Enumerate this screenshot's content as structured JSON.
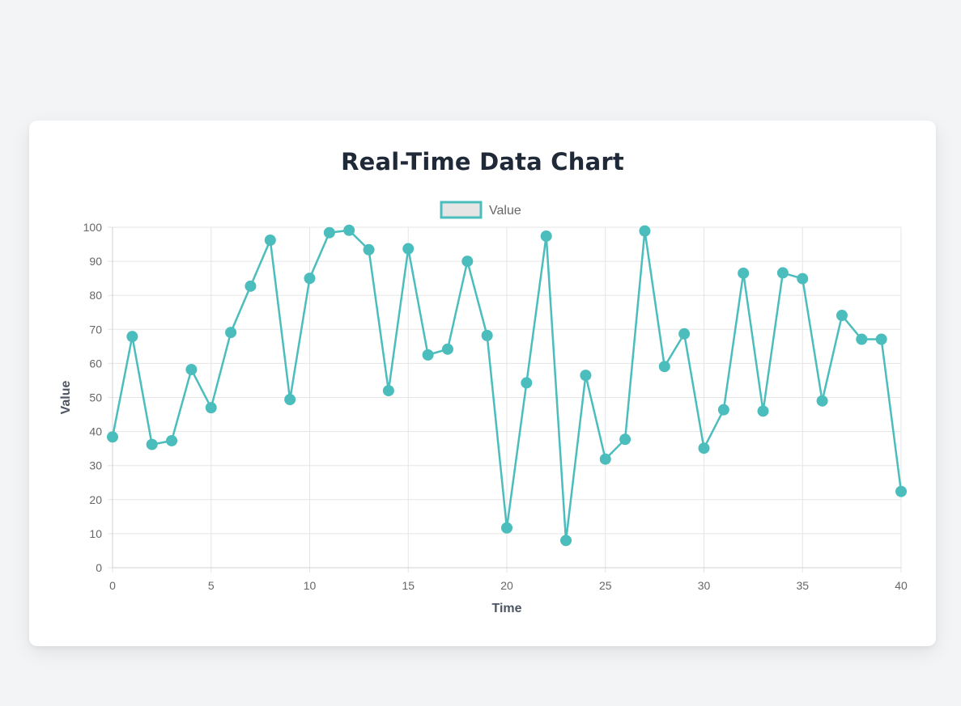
{
  "page": {
    "title": "Real-Time Data Chart"
  },
  "chart_data": {
    "type": "line",
    "title": "Real-Time Data Chart",
    "xlabel": "Time",
    "ylabel": "Value",
    "xlim": [
      0,
      40
    ],
    "ylim": [
      0,
      100
    ],
    "x_ticks": [
      0,
      5,
      10,
      15,
      20,
      25,
      30,
      35,
      40
    ],
    "y_ticks": [
      0,
      10,
      20,
      30,
      40,
      50,
      60,
      70,
      80,
      90,
      100
    ],
    "grid": true,
    "legend_position": "top-center",
    "colors": {
      "line": "#4bbdbd",
      "legend_fill": "#e5e5e5",
      "grid": "#e5e5e5",
      "axis": "#d0d0d0"
    },
    "series": [
      {
        "name": "Value",
        "x": [
          0,
          1,
          2,
          3,
          4,
          5,
          6,
          7,
          8,
          9,
          10,
          11,
          12,
          13,
          14,
          15,
          16,
          17,
          18,
          19,
          20,
          21,
          22,
          23,
          24,
          25,
          26,
          27,
          28,
          29,
          30,
          31,
          32,
          33,
          34,
          35,
          36,
          37,
          38,
          39,
          40
        ],
        "values": [
          38.4,
          67.9,
          36.2,
          37.3,
          58.2,
          47.0,
          69.1,
          82.7,
          96.2,
          49.4,
          85.0,
          98.4,
          99.1,
          93.4,
          52.0,
          93.7,
          62.5,
          64.2,
          90.0,
          68.2,
          11.7,
          54.3,
          97.4,
          8.0,
          56.5,
          31.9,
          37.7,
          98.9,
          59.1,
          68.7,
          35.1,
          46.4,
          86.5,
          46.0,
          86.6,
          84.9,
          49.0,
          74.1,
          67.1,
          67.1,
          22.4
        ]
      }
    ]
  }
}
